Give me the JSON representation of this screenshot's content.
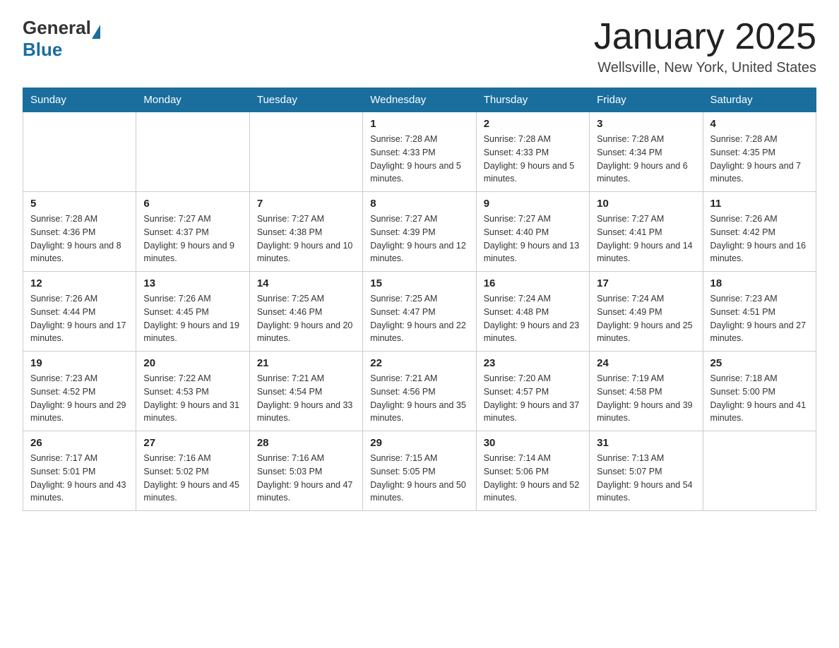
{
  "header": {
    "logo_general": "General",
    "logo_blue": "Blue",
    "month_title": "January 2025",
    "location": "Wellsville, New York, United States"
  },
  "days_of_week": [
    "Sunday",
    "Monday",
    "Tuesday",
    "Wednesday",
    "Thursday",
    "Friday",
    "Saturday"
  ],
  "weeks": [
    [
      {
        "day": "",
        "info": ""
      },
      {
        "day": "",
        "info": ""
      },
      {
        "day": "",
        "info": ""
      },
      {
        "day": "1",
        "info": "Sunrise: 7:28 AM\nSunset: 4:33 PM\nDaylight: 9 hours and 5 minutes."
      },
      {
        "day": "2",
        "info": "Sunrise: 7:28 AM\nSunset: 4:33 PM\nDaylight: 9 hours and 5 minutes."
      },
      {
        "day": "3",
        "info": "Sunrise: 7:28 AM\nSunset: 4:34 PM\nDaylight: 9 hours and 6 minutes."
      },
      {
        "day": "4",
        "info": "Sunrise: 7:28 AM\nSunset: 4:35 PM\nDaylight: 9 hours and 7 minutes."
      }
    ],
    [
      {
        "day": "5",
        "info": "Sunrise: 7:28 AM\nSunset: 4:36 PM\nDaylight: 9 hours and 8 minutes."
      },
      {
        "day": "6",
        "info": "Sunrise: 7:27 AM\nSunset: 4:37 PM\nDaylight: 9 hours and 9 minutes."
      },
      {
        "day": "7",
        "info": "Sunrise: 7:27 AM\nSunset: 4:38 PM\nDaylight: 9 hours and 10 minutes."
      },
      {
        "day": "8",
        "info": "Sunrise: 7:27 AM\nSunset: 4:39 PM\nDaylight: 9 hours and 12 minutes."
      },
      {
        "day": "9",
        "info": "Sunrise: 7:27 AM\nSunset: 4:40 PM\nDaylight: 9 hours and 13 minutes."
      },
      {
        "day": "10",
        "info": "Sunrise: 7:27 AM\nSunset: 4:41 PM\nDaylight: 9 hours and 14 minutes."
      },
      {
        "day": "11",
        "info": "Sunrise: 7:26 AM\nSunset: 4:42 PM\nDaylight: 9 hours and 16 minutes."
      }
    ],
    [
      {
        "day": "12",
        "info": "Sunrise: 7:26 AM\nSunset: 4:44 PM\nDaylight: 9 hours and 17 minutes."
      },
      {
        "day": "13",
        "info": "Sunrise: 7:26 AM\nSunset: 4:45 PM\nDaylight: 9 hours and 19 minutes."
      },
      {
        "day": "14",
        "info": "Sunrise: 7:25 AM\nSunset: 4:46 PM\nDaylight: 9 hours and 20 minutes."
      },
      {
        "day": "15",
        "info": "Sunrise: 7:25 AM\nSunset: 4:47 PM\nDaylight: 9 hours and 22 minutes."
      },
      {
        "day": "16",
        "info": "Sunrise: 7:24 AM\nSunset: 4:48 PM\nDaylight: 9 hours and 23 minutes."
      },
      {
        "day": "17",
        "info": "Sunrise: 7:24 AM\nSunset: 4:49 PM\nDaylight: 9 hours and 25 minutes."
      },
      {
        "day": "18",
        "info": "Sunrise: 7:23 AM\nSunset: 4:51 PM\nDaylight: 9 hours and 27 minutes."
      }
    ],
    [
      {
        "day": "19",
        "info": "Sunrise: 7:23 AM\nSunset: 4:52 PM\nDaylight: 9 hours and 29 minutes."
      },
      {
        "day": "20",
        "info": "Sunrise: 7:22 AM\nSunset: 4:53 PM\nDaylight: 9 hours and 31 minutes."
      },
      {
        "day": "21",
        "info": "Sunrise: 7:21 AM\nSunset: 4:54 PM\nDaylight: 9 hours and 33 minutes."
      },
      {
        "day": "22",
        "info": "Sunrise: 7:21 AM\nSunset: 4:56 PM\nDaylight: 9 hours and 35 minutes."
      },
      {
        "day": "23",
        "info": "Sunrise: 7:20 AM\nSunset: 4:57 PM\nDaylight: 9 hours and 37 minutes."
      },
      {
        "day": "24",
        "info": "Sunrise: 7:19 AM\nSunset: 4:58 PM\nDaylight: 9 hours and 39 minutes."
      },
      {
        "day": "25",
        "info": "Sunrise: 7:18 AM\nSunset: 5:00 PM\nDaylight: 9 hours and 41 minutes."
      }
    ],
    [
      {
        "day": "26",
        "info": "Sunrise: 7:17 AM\nSunset: 5:01 PM\nDaylight: 9 hours and 43 minutes."
      },
      {
        "day": "27",
        "info": "Sunrise: 7:16 AM\nSunset: 5:02 PM\nDaylight: 9 hours and 45 minutes."
      },
      {
        "day": "28",
        "info": "Sunrise: 7:16 AM\nSunset: 5:03 PM\nDaylight: 9 hours and 47 minutes."
      },
      {
        "day": "29",
        "info": "Sunrise: 7:15 AM\nSunset: 5:05 PM\nDaylight: 9 hours and 50 minutes."
      },
      {
        "day": "30",
        "info": "Sunrise: 7:14 AM\nSunset: 5:06 PM\nDaylight: 9 hours and 52 minutes."
      },
      {
        "day": "31",
        "info": "Sunrise: 7:13 AM\nSunset: 5:07 PM\nDaylight: 9 hours and 54 minutes."
      },
      {
        "day": "",
        "info": ""
      }
    ]
  ]
}
